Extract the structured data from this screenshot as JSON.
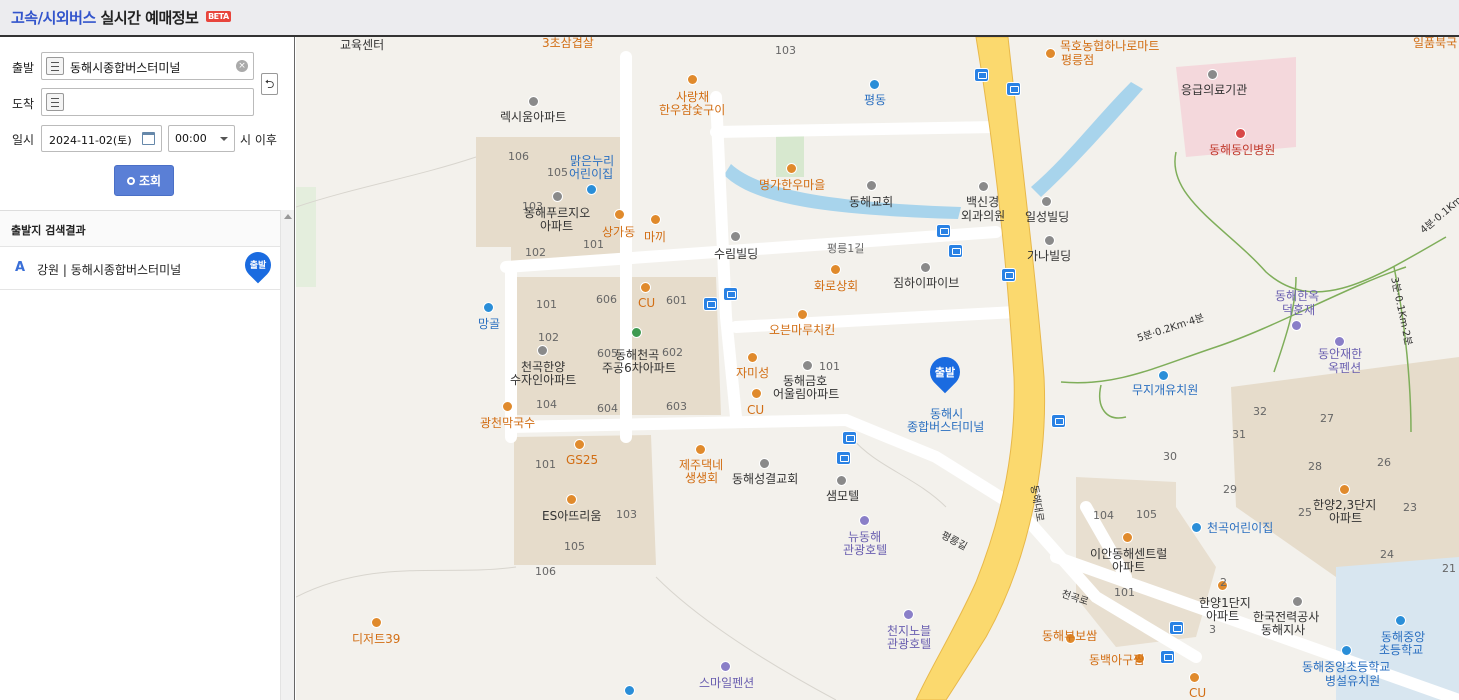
{
  "header": {
    "title_brand": "고속/시외버스",
    "title_rest": "실시간 예매정보",
    "beta_badge": "BETA"
  },
  "form": {
    "departure_label": "출발",
    "departure_value": "동해시종합버스터미널",
    "arrival_label": "도착",
    "arrival_value": "",
    "datetime_label": "일시",
    "date_value": "2024-11-02(토)",
    "time_value": "00:00",
    "after_label": "시 이후",
    "search_button": "조회"
  },
  "results": {
    "heading": "출발지 검색결과",
    "items": [
      {
        "letter": "A",
        "name": "강원 | 동해시종합버스터미널",
        "pin_label": "출발"
      }
    ]
  },
  "map": {
    "start_marker_label": "출발",
    "labels": [
      "교육센터",
      "3초삼겹살",
      "103",
      "목호농협하나로마트",
      "평릉점",
      "일품북국",
      "사랑채",
      "한우참숯구이",
      "평동",
      "응급의료기관",
      "렉시움아파트",
      "106",
      "맑은누리",
      "어린이집",
      "105",
      "동해동인병원",
      "명가한우마을",
      "동해교회",
      "백신경",
      "외과의원",
      "일성빌딩",
      "103",
      "동해푸르지오",
      "아파트",
      "상가동",
      "마끼",
      "102",
      "101",
      "수림빌딩",
      "평릉1길",
      "가나빌딩",
      "606",
      "601",
      "CU",
      "화로상회",
      "짐하이파이브",
      "동해한옥",
      "덕훈재",
      "101",
      "망골",
      "오븐마루치킨",
      "102",
      "605",
      "동해천곡",
      "주공6차아파트",
      "602",
      "동안재한",
      "옥펜션",
      "천곡한양",
      "수자인아파트",
      "자미성",
      "101",
      "동해금호",
      "어울림아파트",
      "동해시",
      "종합버스터미널",
      "무지개유치원",
      "104",
      "604",
      "603",
      "CU",
      "32",
      "27",
      "광천막국수",
      "31",
      "GS25",
      "101",
      "제주댁네",
      "생생회",
      "동해성결교회",
      "30",
      "28",
      "26",
      "샘모텔",
      "ES아뜨리움",
      "103",
      "29",
      "한양2,3단지",
      "아파트",
      "104",
      "105",
      "천곡어린이집",
      "25",
      "23",
      "105",
      "뉴동해",
      "관광호텔",
      "이안동해센트럴",
      "아파트",
      "24",
      "21",
      "106",
      "평릉길",
      "동해대로",
      "2",
      "101",
      "한양1단지",
      "아파트",
      "한국전력공사",
      "동해지사",
      "동해중앙",
      "초등학교",
      "디저트39",
      "천지노블",
      "관광호텔",
      "3",
      "동해부보쌈",
      "천곡로",
      "동백아구찜",
      "동해중앙초등학교",
      "병설유치원",
      "스마일펜션",
      "CU"
    ],
    "trail_labels": [
      "5분·0.2Km·4분",
      "3분·0.1Km·2분",
      "4분·0.1Km"
    ]
  },
  "icons": {
    "list": "list-icon",
    "clear": "clear-icon",
    "swap": "swap-icon",
    "calendar": "calendar-icon",
    "search": "search-icon",
    "bus": "bus-stop-icon"
  },
  "colors": {
    "brand": "#3355cc",
    "button": "#5a7fd6",
    "pin": "#1a6be0",
    "main_road": "#fbd96e",
    "stream": "#a8d4ec",
    "apartment_block": "#e6dccb"
  }
}
